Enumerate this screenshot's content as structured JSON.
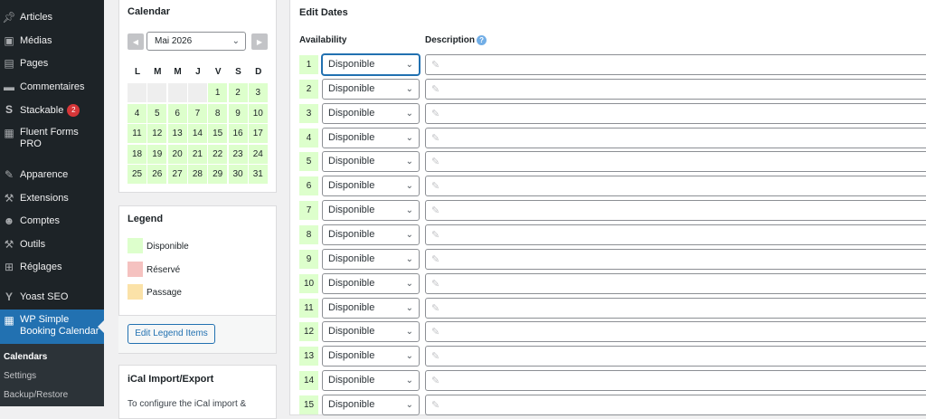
{
  "sidebar": {
    "items": [
      {
        "label": "Articles",
        "icon": "pin-icon"
      },
      {
        "label": "Médias",
        "icon": "media-icon"
      },
      {
        "label": "Pages",
        "icon": "page-icon"
      },
      {
        "label": "Commentaires",
        "icon": "comment-icon"
      },
      {
        "label": "Stackable",
        "icon": "stackable-icon",
        "badge": "2"
      },
      {
        "label": "Fluent Forms",
        "label2": "PRO",
        "icon": "forms-icon"
      },
      {
        "label": "Apparence",
        "icon": "brush-icon"
      },
      {
        "label": "Extensions",
        "icon": "plugin-icon"
      },
      {
        "label": "Comptes",
        "icon": "user-icon"
      },
      {
        "label": "Outils",
        "icon": "wrench-icon"
      },
      {
        "label": "Réglages",
        "icon": "settings-icon"
      },
      {
        "label": "Yoast SEO",
        "icon": "yoast-icon"
      },
      {
        "label": "WP Simple",
        "label2": "Booking Calendar",
        "icon": "calendar-icon"
      }
    ],
    "submenu": [
      "Calendars",
      "Settings",
      "Backup/Restore"
    ]
  },
  "calendar_panel": {
    "title": "Calendar",
    "month": "Mai 2026",
    "weekdays": [
      "L",
      "M",
      "M",
      "J",
      "V",
      "S",
      "D"
    ],
    "days": [
      "1",
      "2",
      "3",
      "4",
      "5",
      "6",
      "7",
      "8",
      "9",
      "10",
      "11",
      "12",
      "13",
      "14",
      "15",
      "16",
      "17",
      "18",
      "19",
      "20",
      "21",
      "22",
      "23",
      "24",
      "25",
      "26",
      "27",
      "28",
      "29",
      "30",
      "31"
    ]
  },
  "legend_panel": {
    "title": "Legend",
    "items": [
      {
        "label": "Disponible",
        "color": "#ddffcc"
      },
      {
        "label": "Réservé",
        "color": "#f5c2c0"
      },
      {
        "label": "Passage",
        "color": "#fbe2a8"
      }
    ],
    "button": "Edit Legend Items"
  },
  "ical_panel": {
    "title": "iCal Import/Export",
    "text": "To configure the iCal import &"
  },
  "edit_dates": {
    "title": "Edit Dates",
    "col_availability": "Availability",
    "col_description": "Description",
    "help": "?",
    "rows": [
      {
        "day": "1",
        "availability": "Disponible"
      },
      {
        "day": "2",
        "availability": "Disponible"
      },
      {
        "day": "3",
        "availability": "Disponible"
      },
      {
        "day": "4",
        "availability": "Disponible"
      },
      {
        "day": "5",
        "availability": "Disponible"
      },
      {
        "day": "6",
        "availability": "Disponible"
      },
      {
        "day": "7",
        "availability": "Disponible"
      },
      {
        "day": "8",
        "availability": "Disponible"
      },
      {
        "day": "9",
        "availability": "Disponible"
      },
      {
        "day": "10",
        "availability": "Disponible"
      },
      {
        "day": "11",
        "availability": "Disponible"
      },
      {
        "day": "12",
        "availability": "Disponible"
      },
      {
        "day": "13",
        "availability": "Disponible"
      },
      {
        "day": "14",
        "availability": "Disponible"
      },
      {
        "day": "15",
        "availability": "Disponible"
      }
    ]
  }
}
